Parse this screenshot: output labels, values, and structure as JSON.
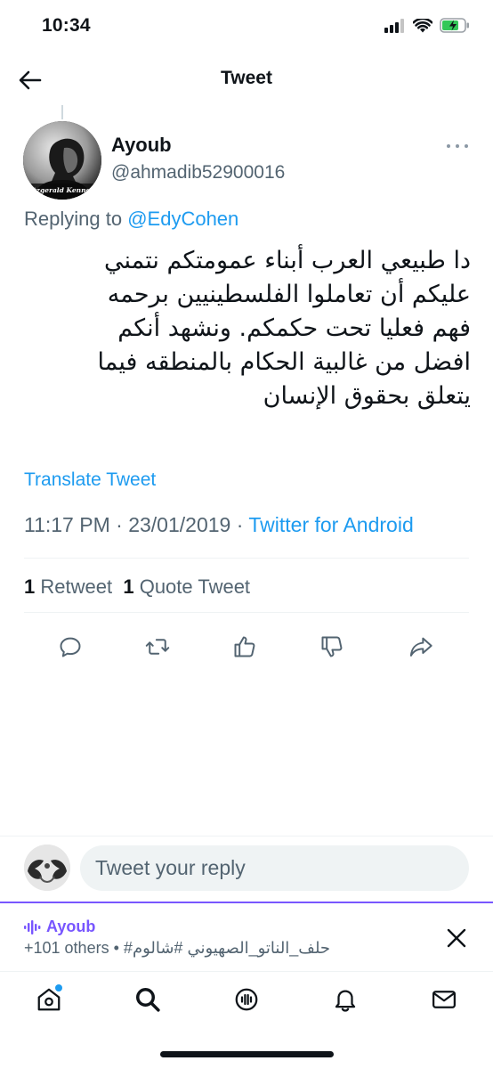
{
  "status_bar": {
    "time": "10:34"
  },
  "header": {
    "title": "Tweet",
    "back_icon": "arrow-left-icon"
  },
  "tweet": {
    "author_name": "Ayoub",
    "author_handle": "@ahmadib52900016",
    "avatar_caption": "Fitzgerald Kennedy",
    "replying_label": "Replying to",
    "replying_to": "@EdyCohen",
    "text_lines": [
      "دا طبيعي العرب أبناء عمومتكم نتمني",
      "عليكم أن تعاملوا الفلسطينيين برحمه",
      "فهم فعليا تحت حكمكم. ونشهد أنكم",
      "افضل من غالبية الحكام بالمنطقه فيما",
      "يتعلق بحقوق الإنسان"
    ],
    "translate_label": "Translate Tweet",
    "time": "11:17 PM",
    "date": "23/01/2019",
    "separator": "·",
    "source": "Twitter for Android",
    "retweet_count": "1",
    "retweet_label": "Retweet",
    "quote_count": "1",
    "quote_label": "Quote Tweet"
  },
  "reply": {
    "placeholder": "Tweet your reply"
  },
  "spaces": {
    "host": "Ayoub",
    "others": "+101 others",
    "dot": "•",
    "hashtags": "#حلف_الناتو_الصهيوني #شالوم",
    "accent": "#7856ff"
  },
  "tabs": [
    "home-icon",
    "search-icon",
    "spaces-icon",
    "notifications-icon",
    "messages-icon"
  ],
  "colors": {
    "accent": "#1d9bf0",
    "text": "#0f1419",
    "secondary": "#536471"
  }
}
